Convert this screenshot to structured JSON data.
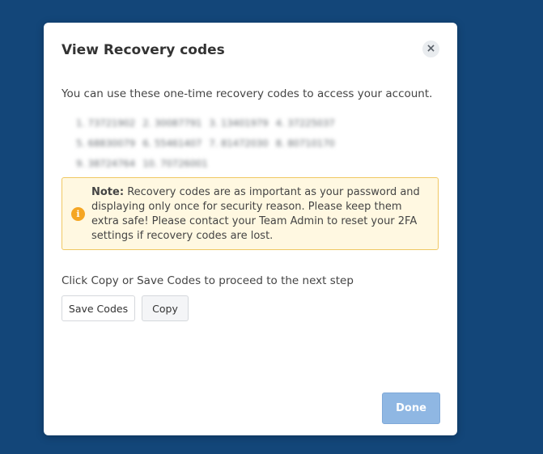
{
  "modal": {
    "title": "View Recovery codes",
    "close_icon": "×",
    "intro_text": "You can use these one-time recovery codes to access your account.",
    "codes": [
      {
        "index": "1.",
        "code": "73721902"
      },
      {
        "index": "2.",
        "code": "30087791"
      },
      {
        "index": "3.",
        "code": "13401979"
      },
      {
        "index": "4.",
        "code": "37225037"
      },
      {
        "index": "5.",
        "code": "68830079"
      },
      {
        "index": "6.",
        "code": "55461407"
      },
      {
        "index": "7.",
        "code": "81472030"
      },
      {
        "index": "8.",
        "code": "80710170"
      },
      {
        "index": "9.",
        "code": "38724764"
      },
      {
        "index": "10.",
        "code": "70726001"
      }
    ],
    "codes_blurred": true,
    "note": {
      "icon": "info-warning-icon",
      "icon_glyph": "i",
      "label": "Note:",
      "text": "Recovery codes are as important as your password and displaying only once for security reason. Please keep them extra safe! Please contact your Team Admin to reset your 2FA settings if recovery codes are lost."
    },
    "instruction": "Click Copy or Save Codes to proceed to the next step",
    "buttons": {
      "save_codes": "Save Codes",
      "copy": "Copy",
      "done": "Done"
    }
  },
  "colors": {
    "backdrop": "#134679",
    "note_background": "#fff8e1",
    "note_border": "#f0c862",
    "warning_icon": "#f5a623",
    "done_button": "#8fb7e3"
  }
}
